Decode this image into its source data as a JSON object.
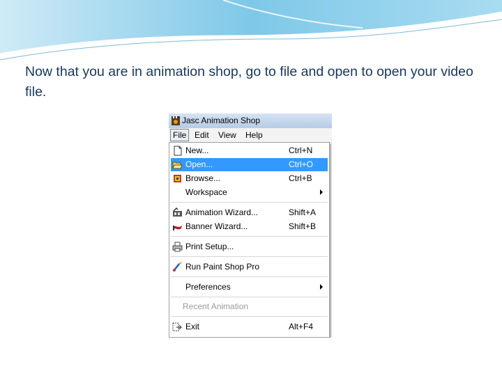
{
  "caption": "Now that you are in animation shop, go to file and open to open your video file.",
  "window": {
    "title": "Jasc Animation Shop",
    "app_icon": "film-clapper-icon"
  },
  "menubar": [
    "File",
    "Edit",
    "View",
    "Help"
  ],
  "menu": {
    "new": {
      "label": "New...",
      "shortcut": "Ctrl+N",
      "icon": "new-document-icon"
    },
    "open": {
      "label": "Open...",
      "shortcut": "Ctrl+O",
      "icon": "open-folder-icon"
    },
    "browse": {
      "label": "Browse...",
      "shortcut": "Ctrl+B",
      "icon": "browse-icon"
    },
    "workspace": {
      "label": "Workspace"
    },
    "anim_wizard": {
      "label": "Animation Wizard...",
      "shortcut": "Shift+A",
      "icon": "animation-wizard-icon"
    },
    "banner_wizard": {
      "label": "Banner Wizard...",
      "shortcut": "Shift+B",
      "icon": "banner-wizard-icon"
    },
    "print_setup": {
      "label": "Print Setup...",
      "icon": "printer-icon"
    },
    "run_psp": {
      "label": "Run Paint Shop Pro",
      "icon": "paint-brush-icon"
    },
    "preferences": {
      "label": "Preferences"
    },
    "recent": {
      "label": "Recent Animation"
    },
    "exit": {
      "label": "Exit",
      "shortcut": "Alt+F4",
      "icon": "exit-icon"
    }
  },
  "colors": {
    "highlight": "#3399ff",
    "caption": "#17375e"
  }
}
